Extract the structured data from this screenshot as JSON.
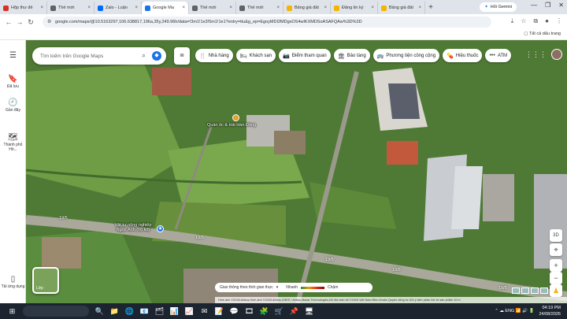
{
  "browser": {
    "tabs": [
      {
        "label": "Hộp thư đế",
        "color": "#d93025"
      },
      {
        "label": "Thế mới",
        "color": "#5f6368"
      },
      {
        "label": "Zalo - Luận",
        "color": "#0068ff"
      },
      {
        "label": "Google Ma",
        "color": "#1a73e8",
        "active": true
      },
      {
        "label": "Thế mới",
        "color": "#5f6368"
      },
      {
        "label": "Thế mới",
        "color": "#5f6368"
      },
      {
        "label": "Bảng giá đất",
        "color": "#f4b400"
      },
      {
        "label": "Đăng tin ký",
        "color": "#f4b400"
      },
      {
        "label": "Bảng giá đất",
        "color": "#f4b400"
      }
    ],
    "tab_close": "×",
    "new_tab": "+",
    "gemini_label": "Hỏi Gemini",
    "window_controls": [
      "—",
      "❐",
      "✕"
    ],
    "url": "google.com/maps/@10.5163297,106.638817,196a,35y,249.96h/data=!3m1!1e3!5m1!1e1?entry=ttu&g_ep=EgoyMDI2MDgxOS4wIKXMDSoASAFQAw%3D%3D",
    "nav": {
      "back": "←",
      "forward": "→",
      "reload": "↻"
    },
    "all_bookmarks": "Tất cả dấu trang"
  },
  "left_panel": {
    "menu_icon": "☰",
    "items": [
      {
        "icon": "🔖",
        "label": "Đã lưu"
      },
      {
        "icon": "🕘",
        "label": "Gần đây"
      },
      {
        "icon": "🗺",
        "label": "Thành phố Hồ..."
      }
    ],
    "mobile_label": "Tải ứng dụng"
  },
  "map": {
    "search_placeholder": "Tìm kiếm trên Google Maps",
    "hotel_icon": "≣",
    "chips": [
      {
        "icon": "🍴",
        "label": "Nhà hàng"
      },
      {
        "icon": "🛏",
        "label": "Khách sạn"
      },
      {
        "icon": "📷",
        "label": "Điểm tham quan"
      },
      {
        "icon": "🏛",
        "label": "Bảo tàng"
      },
      {
        "icon": "🚌",
        "label": "Phương tiện công cộng"
      },
      {
        "icon": "💊",
        "label": "Hiệu thuốc"
      },
      {
        "icon": "•••",
        "label": "ATM"
      }
    ],
    "place_labels": [
      {
        "text": "Quán ốc & Hải Hàn Đăng"
      },
      {
        "text": "Vật tư nông nghiệp Ngọc Ánh (hộ kd)"
      }
    ],
    "road_label": "19/5",
    "layers_label": "Lớp",
    "traffic": {
      "label": "Giao thông theo thời gian thực",
      "fast": "Nhanh",
      "slow": "Chậm"
    },
    "controls": {
      "compass": "⌖",
      "zoom_in": "+",
      "zoom_out": "−",
      "pegman": "♟",
      "tilt": "3D"
    },
    "attribution": "Hình ảnh ©2026 Airbus,Hình ảnh ©2026 Airbus,CNES / Airbus,Maxar Technologies,Dữ liệu bản đồ ©2026   Việt Nam   Điều khoản   Quyền riêng tư   Gửi ý kiến phản hồi về sản phẩm   10 m"
  },
  "taskbar": {
    "start_icon": "⊞",
    "apps": [
      "🔍",
      "📁",
      "🌐",
      "📧",
      "🗂",
      "📊",
      "📈",
      "✉",
      "📝",
      "💬",
      "🎞",
      "🧩",
      "🛒",
      "📌",
      "🖥"
    ],
    "tray_icons": "⌃  ☁  ENG  📶  🔊  🔋",
    "time": "04:19 PM",
    "date": "24/08/2026"
  }
}
